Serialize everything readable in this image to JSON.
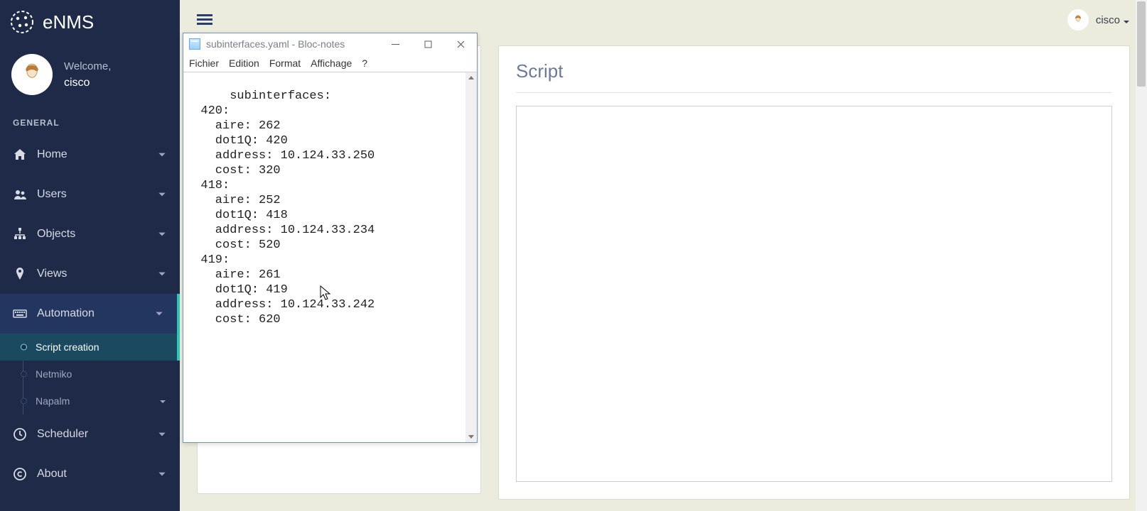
{
  "app": {
    "name": "eNMS"
  },
  "user": {
    "welcome": "Welcome,",
    "name": "cisco"
  },
  "sidebar": {
    "section_label": "GENERAL",
    "items": [
      {
        "id": "home",
        "label": "Home",
        "icon": "home-icon",
        "expandable": true
      },
      {
        "id": "users",
        "label": "Users",
        "icon": "users-icon",
        "expandable": true
      },
      {
        "id": "objects",
        "label": "Objects",
        "icon": "sitemap-icon",
        "expandable": true
      },
      {
        "id": "views",
        "label": "Views",
        "icon": "pin-icon",
        "expandable": true
      },
      {
        "id": "automation",
        "label": "Automation",
        "icon": "keyboard-icon",
        "expandable": true,
        "active": true,
        "children": [
          {
            "id": "script-creation",
            "label": "Script creation",
            "selected": true,
            "expandable": false
          },
          {
            "id": "netmiko",
            "label": "Netmiko",
            "expandable": false
          },
          {
            "id": "napalm",
            "label": "Napalm",
            "expandable": true
          }
        ]
      },
      {
        "id": "scheduler",
        "label": "Scheduler",
        "icon": "clock-icon",
        "expandable": true
      },
      {
        "id": "about",
        "label": "About",
        "icon": "copyright-icon",
        "expandable": true
      }
    ]
  },
  "topbar": {
    "user_label": "cisco"
  },
  "panels": {
    "right_title": "Script"
  },
  "notepad": {
    "title": "subinterfaces.yaml - Bloc-notes",
    "menu": [
      "Fichier",
      "Edition",
      "Format",
      "Affichage",
      "?"
    ],
    "content": "subinterfaces:\n  420:\n    aire: 262\n    dot1Q: 420\n    address: 10.124.33.250\n    cost: 320\n  418:\n    aire: 252\n    dot1Q: 418\n    address: 10.124.33.234\n    cost: 520\n  419:\n    aire: 261\n    dot1Q: 419\n    address: 10.124.33.242\n    cost: 620"
  }
}
